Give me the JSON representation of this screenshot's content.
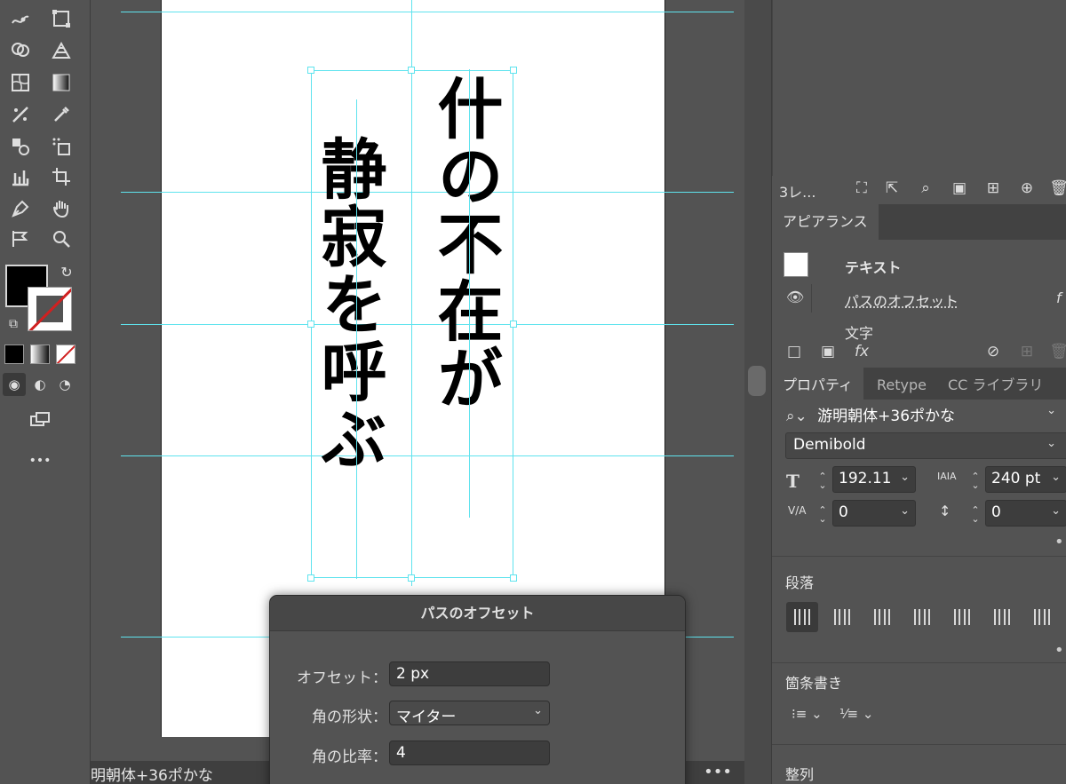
{
  "toolbar": {
    "more_label": "•••"
  },
  "canvas": {
    "column_right": "什の不在が",
    "column_left": "静寂を呼ぶ",
    "status_text": "明朝体+36ポかな",
    "status_more": "•••"
  },
  "dialog": {
    "title": "パスのオフセット",
    "offset_label": "オフセット：",
    "offset_value": "2 px",
    "joins_label": "角の形状：",
    "joins_value": "マイター",
    "miter_label": "角の比率：",
    "miter_value": "4"
  },
  "layers": {
    "count_label": "3レ..."
  },
  "appearance": {
    "tab_label": "アピアランス",
    "object_label": "テキスト",
    "effect_label": "パスのオフセット",
    "characters_label": "文字"
  },
  "properties": {
    "tabs": [
      "プロパティ",
      "Retype",
      "CC ライブラリ"
    ],
    "font_family": "游明朝体+36ポかな",
    "font_style": "Demibold",
    "font_size": "192.11",
    "leading": "240 pt",
    "kerning": "0",
    "tracking": "0",
    "paragraph_title": "段落",
    "bullets_title": "箇条書き",
    "align_title": "整列",
    "more_label": "•••"
  },
  "colors": {
    "guide": "#5fe3ee",
    "panel_bg": "#535353",
    "fill": "#000000",
    "stroke_none_slash": "#d02020"
  }
}
